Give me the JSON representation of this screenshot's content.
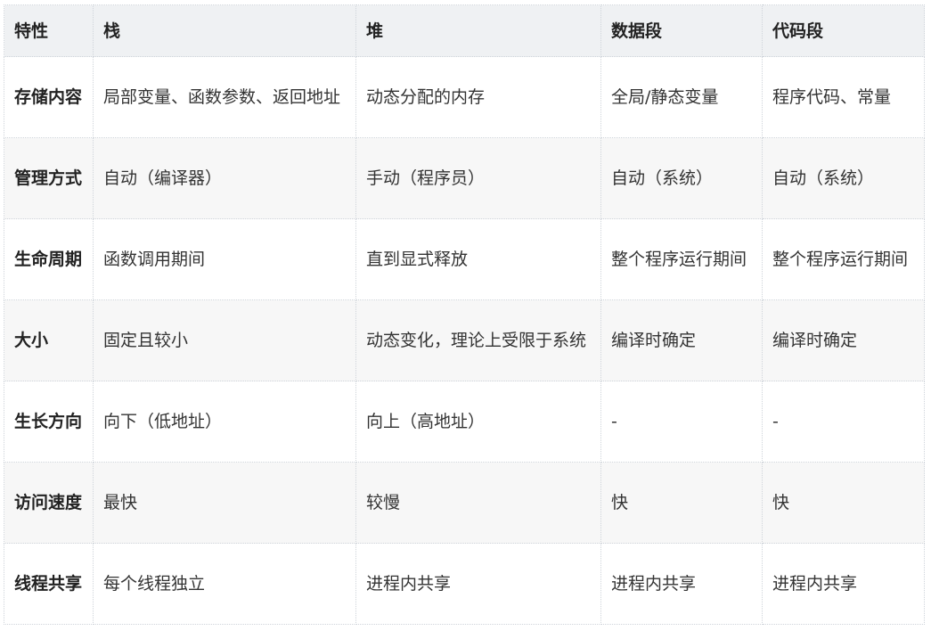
{
  "table": {
    "headers": [
      "特性",
      "栈",
      "堆",
      "数据段",
      "代码段"
    ],
    "rows": [
      [
        "存储内容",
        "局部变量、函数参数、返回地址",
        "动态分配的内存",
        "全局/静态变量",
        "程序代码、常量"
      ],
      [
        "管理方式",
        "自动（编译器）",
        "手动（程序员）",
        "自动（系统）",
        "自动（系统）"
      ],
      [
        "生命周期",
        "函数调用期间",
        "直到显式释放",
        "整个程序运行期间",
        "整个程序运行期间"
      ],
      [
        "大小",
        "固定且较小",
        "动态变化，理论上受限于系统",
        "编译时确定",
        "编译时确定"
      ],
      [
        "生长方向",
        "向下（低地址）",
        "向上（高地址）",
        "-",
        "-"
      ],
      [
        "访问速度",
        "最快",
        "较慢",
        "快",
        "快"
      ],
      [
        "线程共享",
        "每个线程独立",
        "进程内共享",
        "进程内共享",
        "进程内共享"
      ]
    ]
  }
}
